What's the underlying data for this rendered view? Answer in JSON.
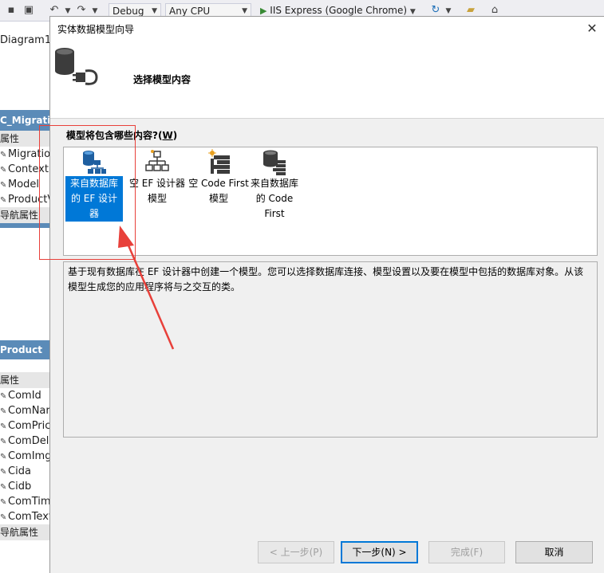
{
  "toolbar": {
    "config": "Debug",
    "platform": "Any CPU",
    "run_target": "IIS Express (Google Chrome)"
  },
  "background": {
    "diagram_tab": "Diagram1]",
    "entity1": {
      "name": "C_Migratio",
      "props_header": "属性",
      "props": [
        "Migratio",
        "ContextK",
        "Model",
        "ProductV"
      ],
      "nav_header": "导航属性"
    },
    "entity2": {
      "name": "Product",
      "props_header": "属性",
      "props": [
        "ComId",
        "ComNar",
        "ComPric",
        "ComDell",
        "ComImg",
        "Cida",
        "Cidb",
        "ComTim",
        "ComText"
      ],
      "nav_header": "导航属性"
    }
  },
  "dialog": {
    "title": "实体数据模型向导",
    "close_glyph": "✕",
    "header_text": "选择模型内容",
    "question_prefix": "模型将包含哪些内容?(",
    "question_key": "W",
    "question_suffix": ")",
    "choices": [
      {
        "label": "来自数据库的 EF 设计器",
        "icon": "database-designer-icon",
        "selected": true
      },
      {
        "label": "空 EF 设计器模型",
        "icon": "hierarchy-icon",
        "selected": false
      },
      {
        "label": "空 Code First 模型",
        "icon": "code-first-icon",
        "selected": false
      },
      {
        "label": "来自数据库的 Code First",
        "icon": "database-code-first-icon",
        "selected": false
      }
    ],
    "description": "基于现有数据库在 EF 设计器中创建一个模型。您可以选择数据库连接、模型设置以及要在模型中包括的数据库对象。从该模型生成您的应用程序将与之交互的类。",
    "buttons": {
      "prev": "< 上一步(P)",
      "next": "下一步(N) >",
      "finish": "完成(F)",
      "cancel": "取消"
    }
  },
  "colors": {
    "selection": "#0078d7",
    "annotation": "#e8403a",
    "entity_header": "#5b8bb8"
  }
}
